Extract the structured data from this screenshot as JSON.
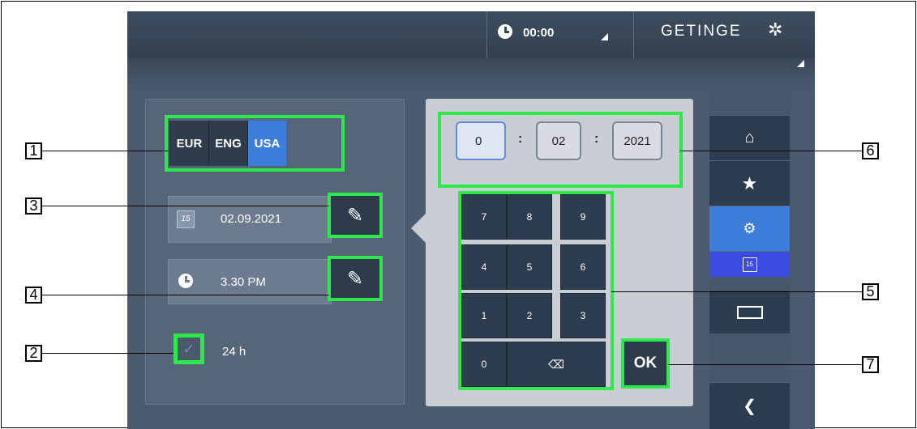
{
  "header": {
    "time": "00:00",
    "brand": "GETINGE",
    "clock_icon": "clock-icon",
    "brand_icon": "asterisk-icon"
  },
  "settings": {
    "format_options": [
      "EUR",
      "ENG",
      "USA"
    ],
    "active_format": "USA",
    "date_value": "02.09.2021",
    "time_value": "3.30 PM",
    "hour24_label": "24 h",
    "hour24_checked": true
  },
  "date_editor": {
    "day": "0",
    "month": "02",
    "year": "2021",
    "separator": ":",
    "keys": [
      "7",
      "8",
      "9",
      "4",
      "5",
      "6",
      "1",
      "2",
      "3",
      "0"
    ],
    "backspace_icon": "backspace-icon",
    "ok_label": "OK"
  },
  "sidebar": {
    "items": [
      "home-icon",
      "star-icon",
      "gears-icon",
      "calendar-icon",
      "battery-icon",
      "back-icon"
    ],
    "active_item": "gears-icon"
  },
  "callouts": [
    "1",
    "2",
    "3",
    "4",
    "5",
    "6",
    "7"
  ],
  "colors": {
    "highlight": "#2ee84c",
    "accent": "#3d7edb",
    "panel_dark": "#2e3c4f"
  }
}
